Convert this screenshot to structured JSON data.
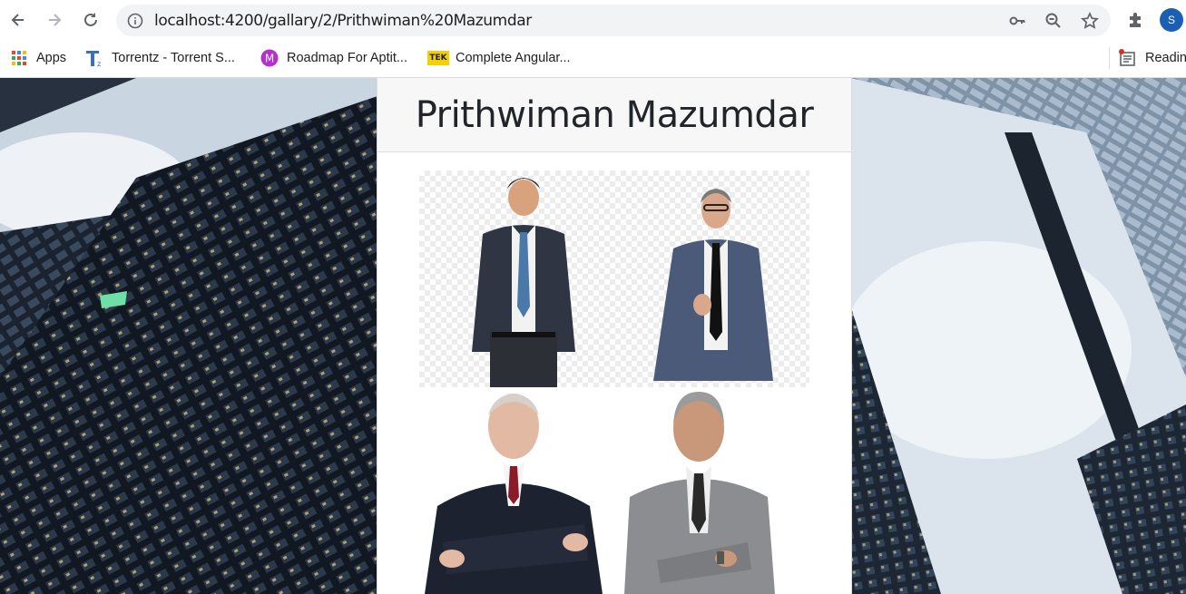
{
  "browser": {
    "url": "localhost:4200/gallary/2/Prithwiman%20Mazumdar",
    "profile_initial": "S",
    "bookmarks": [
      {
        "label": "Apps",
        "icon": "apps-grid-icon"
      },
      {
        "label": "Torrentz - Torrent S...",
        "icon": "torrentz-icon"
      },
      {
        "label": "Roadmap For Aptit...",
        "icon": "m-circle-icon"
      },
      {
        "label": "Complete Angular...",
        "icon": "tek-icon"
      }
    ],
    "reading_list_label": "Readin",
    "tek_icon_text": "TEK",
    "m_icon_text": "M"
  },
  "page": {
    "title": "Prithwiman Mazumdar",
    "gallery": [
      {
        "name": "photo-1",
        "suit": "#2f3542",
        "tie": "#4a78a8"
      },
      {
        "name": "photo-2",
        "suit": "#4a5a78",
        "tie": "#111111"
      },
      {
        "name": "photo-3",
        "suit": "#1d2230",
        "tie": "#8a1c2a"
      },
      {
        "name": "photo-4",
        "suit": "#8b8d90",
        "tie": "#2a2a2a"
      }
    ]
  },
  "colors": {
    "accent": "#1a5fb4",
    "header_bg": "#f7f7f7"
  }
}
